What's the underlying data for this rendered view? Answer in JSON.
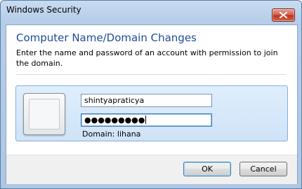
{
  "window": {
    "title": "Windows Security"
  },
  "dialog": {
    "heading": "Computer Name/Domain Changes",
    "description": "Enter the name and password of an account with permission to join the domain."
  },
  "credentials": {
    "username": "shintyapraticya",
    "password_mask": "●●●●●●●●●",
    "domain_label": "Domain: lihana"
  },
  "buttons": {
    "ok": "OK",
    "cancel": "Cancel"
  },
  "colors": {
    "heading": "#1c4c9a",
    "close_button": "#c0331f",
    "tile": "#dfeefc"
  },
  "icons": {
    "close": "close-icon",
    "user_tile": "user-tile-icon"
  }
}
